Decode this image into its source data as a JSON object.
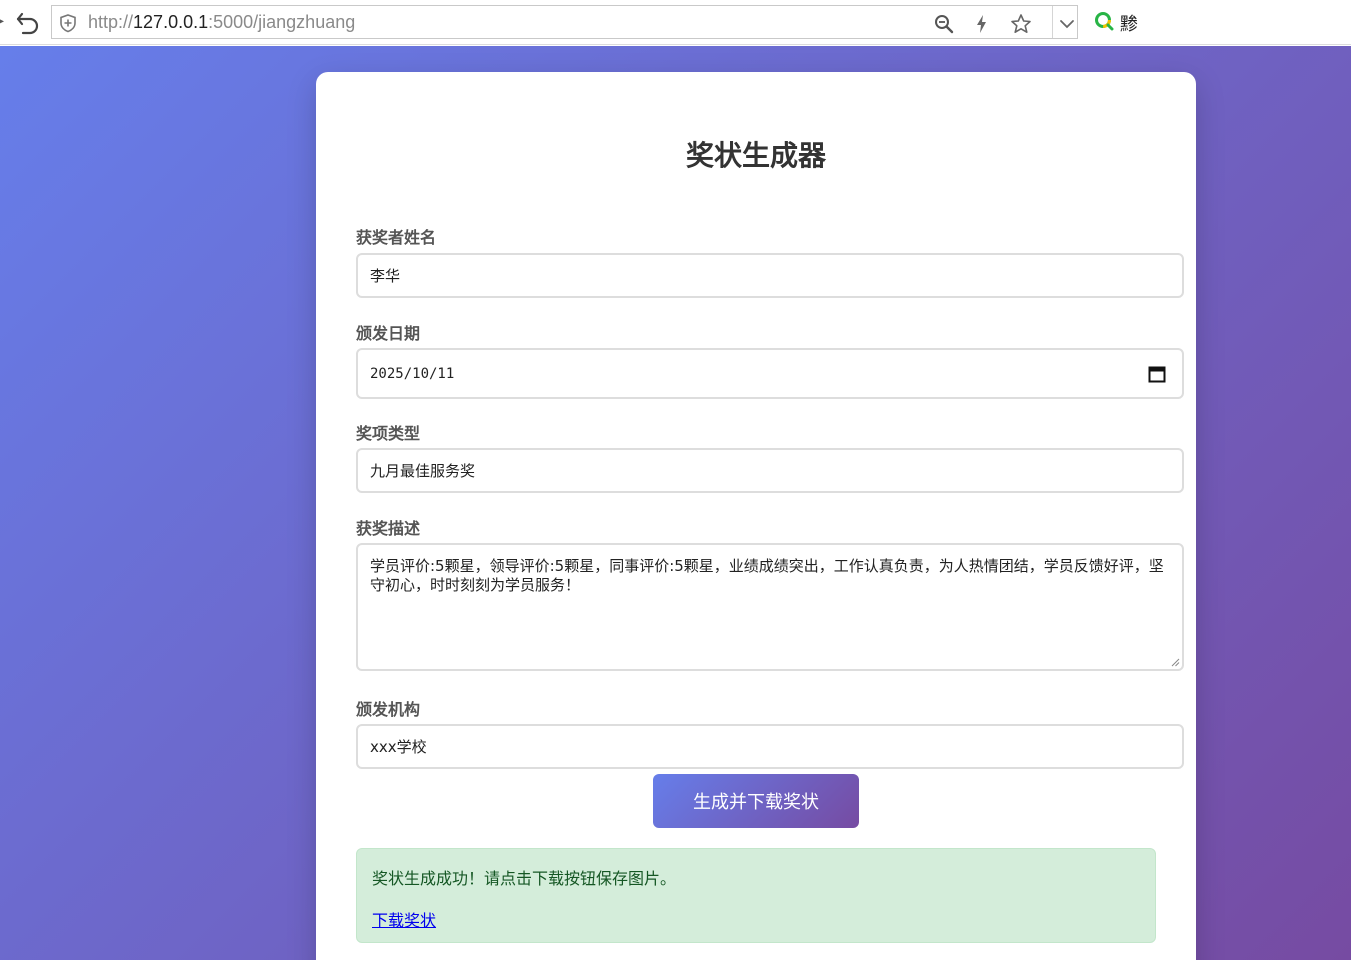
{
  "browser": {
    "url_prefix": "http://",
    "url_host": "127.0.0.1",
    "url_rest": ":5000/jiangzhuang",
    "search_text": "黪"
  },
  "form": {
    "title": "奖状生成器",
    "name_label": "获奖者姓名",
    "name_value": "李华",
    "date_label": "颁发日期",
    "date_value": "2025/10/11",
    "award_label": "奖项类型",
    "award_value": "九月最佳服务奖",
    "desc_label": "获奖描述",
    "desc_value": "学员评价:5颗星，领导评价:5颗星，同事评价:5颗星，业绩成绩突出，工作认真负责，为人热情团结，学员反馈好评，坚守初心，时时刻刻为学员服务！",
    "org_label": "颁发机构",
    "org_value": "xxx学校",
    "submit_label": "生成并下载奖状"
  },
  "result": {
    "message": "奖状生成成功！请点击下载按钮保存图片。",
    "download_link": "下载奖状"
  },
  "colors": {
    "gradient_start": "#667eea",
    "gradient_end": "#764ba2",
    "success_bg": "#d4edda",
    "success_text": "#155724",
    "link": "#0000ee"
  },
  "icons": [
    "back-icon",
    "shield-icon",
    "zoom-icon",
    "bolt-icon",
    "star-icon",
    "chevron-down-icon",
    "search-engine-logo-icon",
    "calendar-icon"
  ]
}
